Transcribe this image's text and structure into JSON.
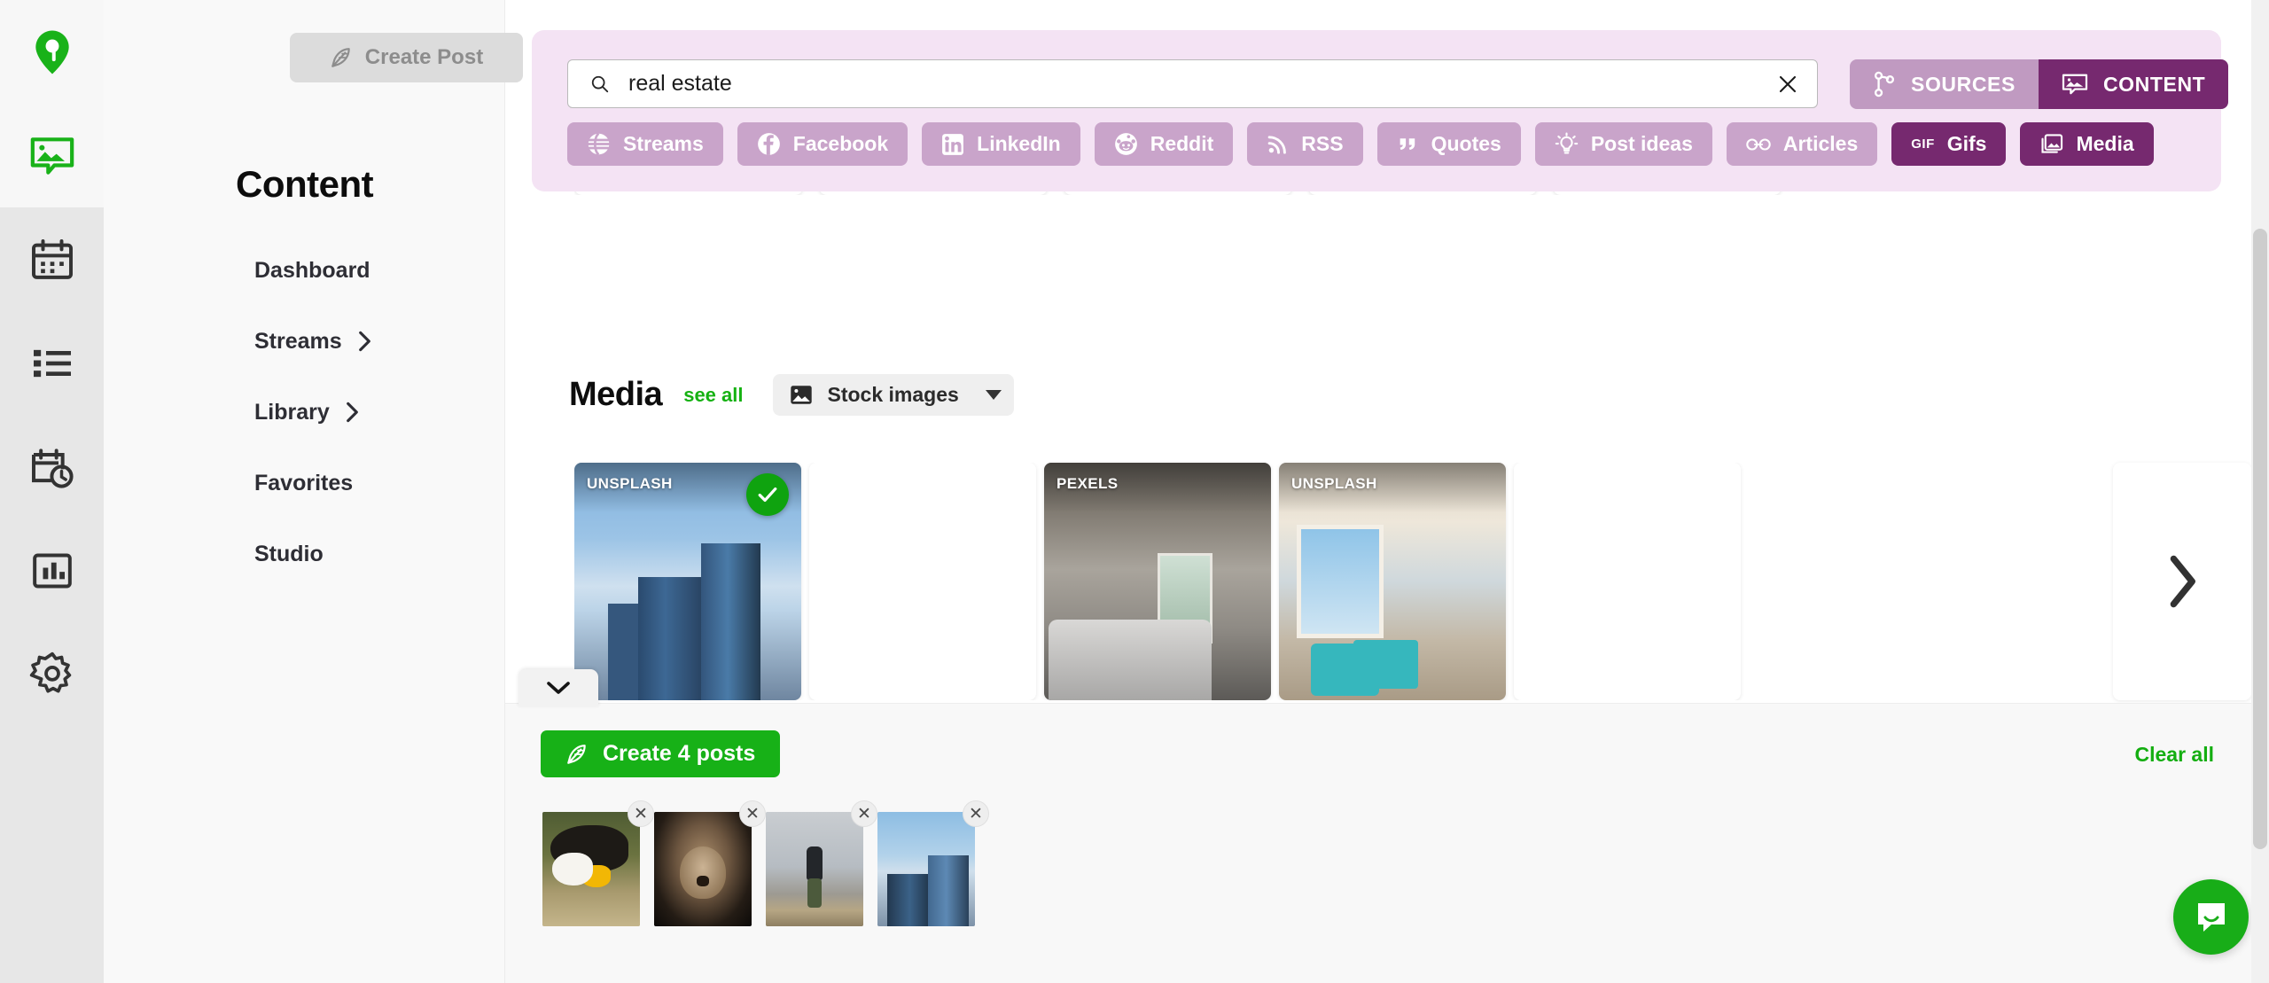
{
  "rail": {
    "items": [
      {
        "name": "logo",
        "icon": "map-pin-logo-icon"
      },
      {
        "name": "content",
        "icon": "content-image-icon"
      },
      {
        "name": "calendar",
        "icon": "calendar-icon"
      },
      {
        "name": "queue",
        "icon": "list-icon"
      },
      {
        "name": "schedule",
        "icon": "calendar-clock-icon"
      },
      {
        "name": "analytics",
        "icon": "bar-chart-icon"
      },
      {
        "name": "settings",
        "icon": "gear-icon"
      }
    ]
  },
  "sidebar": {
    "create_post_label": "Create Post",
    "title": "Content",
    "items": [
      {
        "label": "Dashboard",
        "has_chevron": false
      },
      {
        "label": "Streams",
        "has_chevron": true
      },
      {
        "label": "Library",
        "has_chevron": true
      },
      {
        "label": "Favorites",
        "has_chevron": false
      },
      {
        "label": "Studio",
        "has_chevron": false
      }
    ]
  },
  "search": {
    "value": "real estate",
    "placeholder": "Search",
    "clear_label": "✕",
    "segments": [
      {
        "label": "SOURCES",
        "icon": "branch-icon",
        "active": false
      },
      {
        "label": "CONTENT",
        "icon": "content-image-icon",
        "active": true
      }
    ],
    "pills": [
      {
        "label": "Streams",
        "icon": "streams-icon",
        "active": false
      },
      {
        "label": "Facebook",
        "icon": "facebook-icon",
        "active": false
      },
      {
        "label": "LinkedIn",
        "icon": "linkedin-icon",
        "active": false
      },
      {
        "label": "Reddit",
        "icon": "reddit-icon",
        "active": false
      },
      {
        "label": "RSS",
        "icon": "rss-icon",
        "active": false
      },
      {
        "label": "Quotes",
        "icon": "quote-icon",
        "active": false
      },
      {
        "label": "Post ideas",
        "icon": "lightbulb-icon",
        "active": false
      },
      {
        "label": "Articles",
        "icon": "link-icon",
        "active": false
      },
      {
        "label": "Gifs",
        "icon": "gif-icon",
        "active": true
      },
      {
        "label": "Media",
        "icon": "media-icon",
        "active": true
      }
    ]
  },
  "media": {
    "title": "Media",
    "see_all_label": "see all",
    "source_filter": "Stock images",
    "next_label": "›",
    "collapse_label": "⌄",
    "cards": [
      {
        "source": "UNSPLASH",
        "art": "art-city",
        "selected": true,
        "blank": false
      },
      {
        "source": "",
        "art": "",
        "selected": false,
        "blank": true
      },
      {
        "source": "PEXELS",
        "art": "art-bed",
        "selected": false,
        "blank": false
      },
      {
        "source": "UNSPLASH",
        "art": "art-living",
        "selected": false,
        "blank": false
      },
      {
        "source": "",
        "art": "",
        "selected": false,
        "blank": true
      }
    ]
  },
  "bottom": {
    "create_posts_label": "Create 4 posts",
    "clear_all_label": "Clear all",
    "remove_label": "✕",
    "thumbnails": [
      {
        "alt": "bald-eagle",
        "art": "art-eagle"
      },
      {
        "alt": "lion",
        "art": "art-lion"
      },
      {
        "alt": "runner",
        "art": "art-runner"
      },
      {
        "alt": "buildings",
        "art": "art-bldg"
      }
    ]
  },
  "support": {
    "icon": "chat-bubble-icon"
  },
  "colors": {
    "brand_green": "#17b117",
    "panel_purple": "#f4e3f4",
    "pill_inactive": "#c9a4ca",
    "pill_active": "#76296f"
  }
}
